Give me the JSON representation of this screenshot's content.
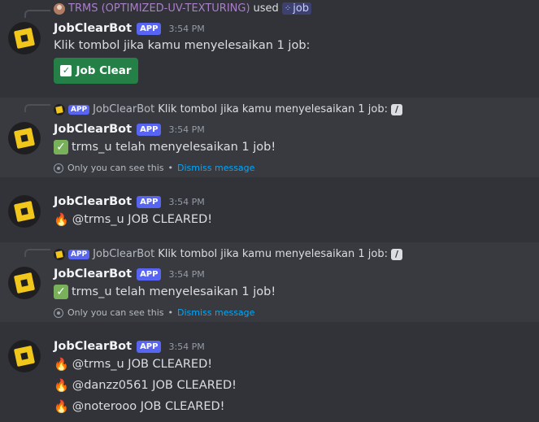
{
  "colors": {
    "background": "#323339",
    "app_badge": "#5865f2",
    "button_green": "#248046",
    "link": "#00a8fc"
  },
  "messages": [
    {
      "reply": {
        "user": "TRMS (OPTIMIZED-UV-TEXTURING)",
        "used": "used",
        "command": "job"
      },
      "author": "JobClearBot",
      "badge": "APP",
      "time": "3:54 PM",
      "lines": [
        "Klik tombol jika kamu menyelesaikan 1 job:"
      ],
      "button": {
        "label": "Job Clear",
        "icon": "check-box-icon"
      }
    },
    {
      "reply": {
        "badge": "APP",
        "user": "JobClearBot",
        "text": "Klik tombol jika kamu menyelesaikan 1 job:"
      },
      "author": "JobClearBot",
      "badge": "APP",
      "time": "3:54 PM",
      "lines": [
        "trms_u telah menyelesaikan 1 job!"
      ],
      "ephemeral": {
        "note": "Only you can see this",
        "sep": "•",
        "dismiss": "Dismiss message"
      }
    },
    {
      "author": "JobClearBot",
      "badge": "APP",
      "time": "3:54 PM",
      "lines": [
        "@trms_u JOB CLEARED!"
      ]
    },
    {
      "reply": {
        "badge": "APP",
        "user": "JobClearBot",
        "text": "Klik tombol jika kamu menyelesaikan 1 job:"
      },
      "author": "JobClearBot",
      "badge": "APP",
      "time": "3:54 PM",
      "lines": [
        "trms_u telah menyelesaikan 1 job!"
      ],
      "ephemeral": {
        "note": "Only you can see this",
        "sep": "•",
        "dismiss": "Dismiss message"
      }
    },
    {
      "author": "JobClearBot",
      "badge": "APP",
      "time": "3:54 PM",
      "lines": [
        "@trms_u JOB CLEARED!",
        "@danzz0561 JOB CLEARED!",
        "@noterooo JOB CLEARED!"
      ]
    }
  ]
}
